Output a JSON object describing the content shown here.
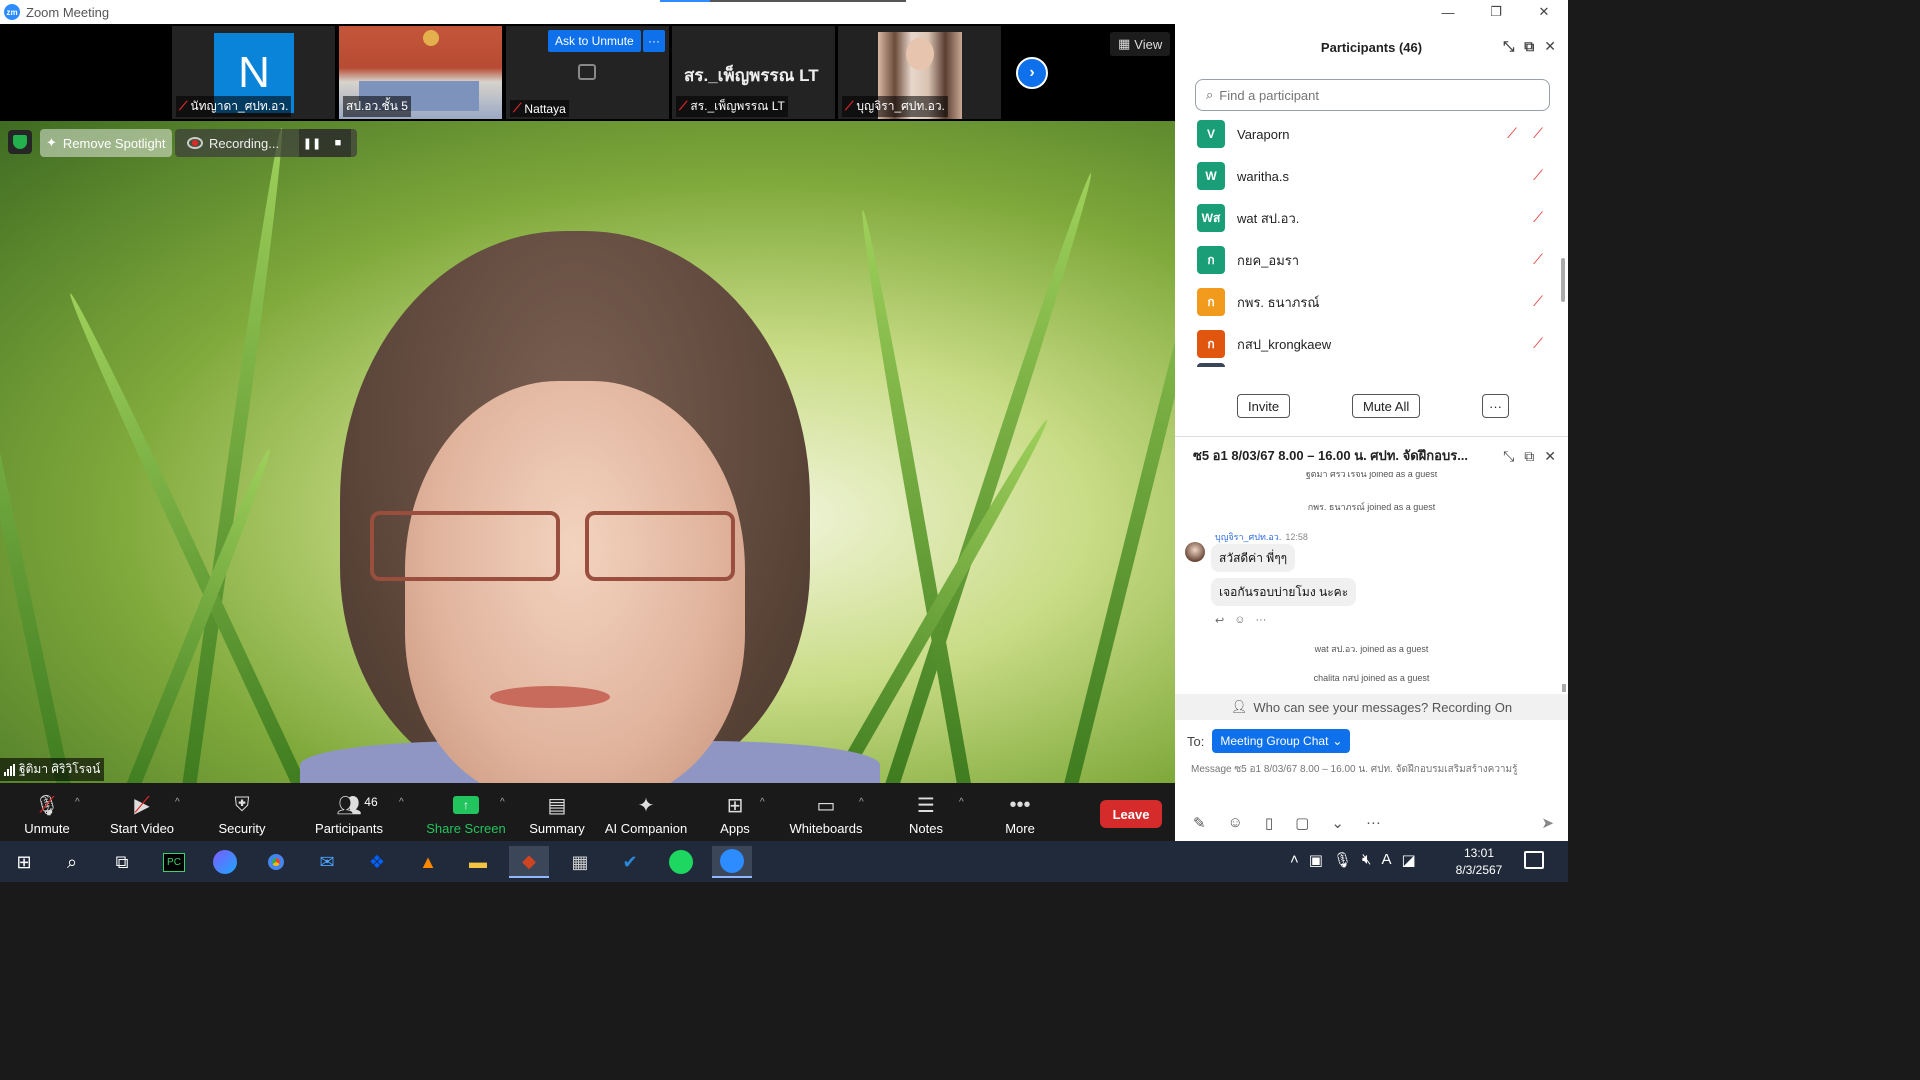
{
  "window": {
    "title": "Zoom Meeting",
    "logo": "zm"
  },
  "strip": {
    "tiles": [
      {
        "name": "นัทญาดา_ศปท.อว.",
        "avatar_letter": "N"
      },
      {
        "name": "สป.อว.ชั้น 5"
      },
      {
        "name": "Nattaya",
        "ask_label": "Ask to Unmute",
        "more_label": "···"
      },
      {
        "name": "สร._เพ็ญพรรณ LT",
        "big_text": "สร._เพ็ญพรรณ LT"
      },
      {
        "name": "บุญจิรา_ศปท.อว."
      }
    ],
    "view_label": "View"
  },
  "main": {
    "spotlight_label": "Remove Spotlight",
    "recording_label": "Recording...",
    "speaker_name": "ฐิติมา ศิริวิโรจน์"
  },
  "toolbar": {
    "unmute": "Unmute",
    "start_video": "Start Video",
    "security": "Security",
    "participants": "Participants",
    "participants_count": "46",
    "share_screen": "Share Screen",
    "summary": "Summary",
    "ai_companion": "AI Companion",
    "apps": "Apps",
    "whiteboards": "Whiteboards",
    "notes": "Notes",
    "more": "More",
    "leave": "Leave"
  },
  "participants": {
    "title": "Participants (46)",
    "search_placeholder": "Find a participant",
    "list": [
      {
        "initials": "V",
        "name": "Varaporn",
        "color": "#1a9e78"
      },
      {
        "initials": "W",
        "name": "waritha.s",
        "color": "#1a9e78"
      },
      {
        "initials": "Wส",
        "name": "wat สป.อว.",
        "color": "#1a9e78"
      },
      {
        "initials": "ก",
        "name": "กยค_อมรา",
        "color": "#1a9e78"
      },
      {
        "initials": "ก",
        "name": "กพร. ธนาภรณ์",
        "color": "#f29a1c"
      },
      {
        "initials": "ก",
        "name": "กสป_krongkaew",
        "color": "#e0560f"
      }
    ],
    "invite": "Invite",
    "mute_all": "Mute All",
    "more": "···"
  },
  "chat": {
    "title": "ซ5 อ1 8/03/67 8.00 – 16.00 น. ศปท. จัดฝึกอบร...",
    "sys_top": "ฐิติมา ศิริวิโรจน์ joined as a guest",
    "sys_1": "กพร. ธนาภรณ์ joined as a guest",
    "sender": "บุญจิรา_ศปท.อว.",
    "time": "12:58",
    "msg1": "สวัสดีค่า พี่ๆๆ",
    "msg2": "เจอกันรอบบ่ายโมง นะคะ",
    "sys_2": "wat สป.อว. joined as a guest",
    "sys_3": "chalita กสป joined as a guest",
    "who_can_see": "Who can see your messages? Recording On",
    "to_label": "To:",
    "to_target": "Meeting Group Chat",
    "message_placeholder": "Message ซ5 อ1 8/03/67 8.00 – 16.00 น. ศปท. จัดฝึกอบรมเสริมสร้างความรู้"
  },
  "taskbar": {
    "time": "13:01",
    "date": "8/3/2567"
  }
}
